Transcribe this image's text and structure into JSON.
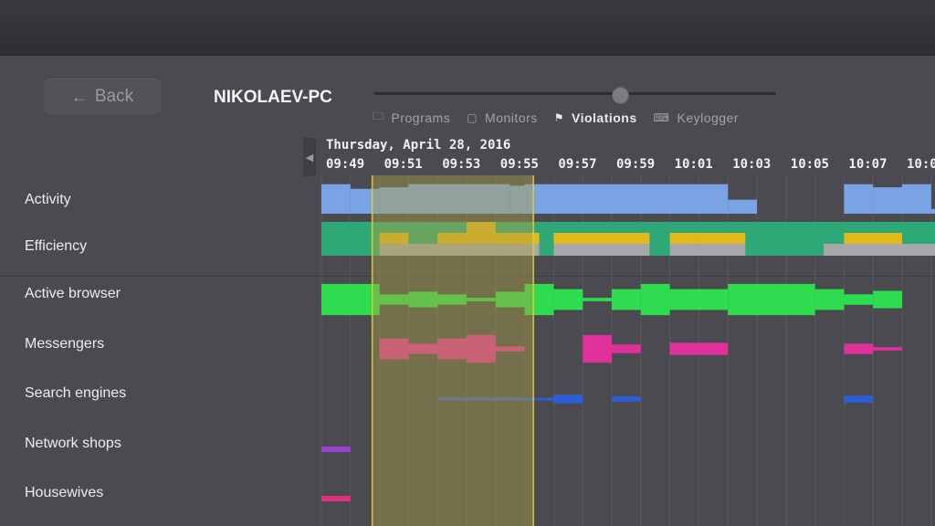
{
  "header": {
    "back_label": "Back",
    "pc_name": "NIKOLAEV-PC",
    "tabs": [
      {
        "label": "Programs",
        "icon": "folder-icon",
        "active": false
      },
      {
        "label": "Monitors",
        "icon": "monitor-icon",
        "active": false
      },
      {
        "label": "Violations",
        "icon": "flag-icon",
        "active": true
      },
      {
        "label": "Keylogger",
        "icon": "keyboard-icon",
        "active": false
      }
    ],
    "zoom_slider": 0.61
  },
  "timeline": {
    "date": "Thursday, April 28, 2016",
    "ticks": [
      "09:49",
      "09:51",
      "09:53",
      "09:55",
      "09:57",
      "09:59",
      "10:01",
      "10:03",
      "10:05",
      "10:07",
      "10:0"
    ],
    "selection": {
      "start": "09:50",
      "end": "09:55:30"
    }
  },
  "rows": [
    {
      "label": "Activity",
      "color": "#7aa3e5"
    },
    {
      "label": "Efficiency",
      "colors": {
        "good": "#2ea876",
        "mid": "#e4b81a",
        "idle": "#a8a8aa"
      }
    },
    {
      "label": "Active browser",
      "color": "#2edc4f"
    },
    {
      "label": "Messengers",
      "color": "#e0309a"
    },
    {
      "label": "Search engines",
      "color": "#2a5fd8"
    },
    {
      "label": "Network shops",
      "color": "#9a3fd6"
    },
    {
      "label": "Housewives",
      "color": "#e0307e"
    }
  ],
  "chart_data": {
    "type": "table",
    "x_unit": "minutes from 09:49",
    "activity": [
      [
        0,
        1,
        0.95
      ],
      [
        1,
        2,
        0.8
      ],
      [
        2,
        3,
        0.85
      ],
      [
        3,
        6.5,
        0.95
      ],
      [
        6.5,
        7,
        0.9
      ],
      [
        7,
        14,
        0.95
      ],
      [
        14,
        15,
        0.45
      ],
      [
        18,
        19,
        0.95
      ],
      [
        19,
        20,
        0.85
      ],
      [
        20,
        21,
        0.95
      ],
      [
        21,
        22,
        0.15
      ]
    ],
    "efficiency": [
      [
        0,
        21.4,
        "good"
      ],
      [
        2,
        3,
        "mid"
      ],
      [
        2,
        3,
        "idle"
      ],
      [
        4,
        6.3,
        "mid"
      ],
      [
        3,
        6.3,
        "idle"
      ],
      [
        5,
        6,
        "mid_tall"
      ],
      [
        6.3,
        7.5,
        "mid"
      ],
      [
        6.3,
        7.5,
        "idle"
      ],
      [
        8,
        11.3,
        "mid"
      ],
      [
        8,
        11.3,
        "idle"
      ],
      [
        12,
        13,
        "mid"
      ],
      [
        12,
        14.6,
        "idle"
      ],
      [
        13,
        14.6,
        "mid"
      ],
      [
        17.3,
        22,
        "idle"
      ],
      [
        18,
        20,
        "mid"
      ]
    ],
    "active_browser": [
      [
        0,
        2,
        0.9
      ],
      [
        2,
        3,
        0.3
      ],
      [
        3,
        4,
        0.45
      ],
      [
        4,
        5,
        0.3
      ],
      [
        5,
        6,
        0.1
      ],
      [
        6,
        7,
        0.45
      ],
      [
        7,
        8,
        0.9
      ],
      [
        8,
        9,
        0.6
      ],
      [
        9,
        10,
        0.1
      ],
      [
        10,
        11,
        0.6
      ],
      [
        11,
        12,
        0.9
      ],
      [
        12,
        14,
        0.6
      ],
      [
        14,
        17,
        0.9
      ],
      [
        17,
        18,
        0.6
      ],
      [
        18,
        19,
        0.3
      ],
      [
        19,
        20,
        0.5
      ]
    ],
    "messengers": [
      [
        2,
        3,
        0.6
      ],
      [
        3,
        4,
        0.3
      ],
      [
        4,
        5,
        0.6
      ],
      [
        5,
        6,
        0.8
      ],
      [
        6,
        7,
        0.15
      ],
      [
        9,
        10,
        0.8
      ],
      [
        10,
        11,
        0.25
      ],
      [
        12,
        14,
        0.35
      ],
      [
        18,
        19,
        0.3
      ],
      [
        19,
        20,
        0.1
      ]
    ],
    "search_engines": [
      [
        4,
        8,
        0.08
      ],
      [
        8,
        9,
        0.25
      ],
      [
        10,
        11,
        0.15
      ],
      [
        18,
        19,
        0.2
      ]
    ],
    "network_shops": [
      [
        0,
        1,
        0.2
      ]
    ],
    "housewives": [
      [
        0,
        1,
        0.2
      ]
    ]
  }
}
